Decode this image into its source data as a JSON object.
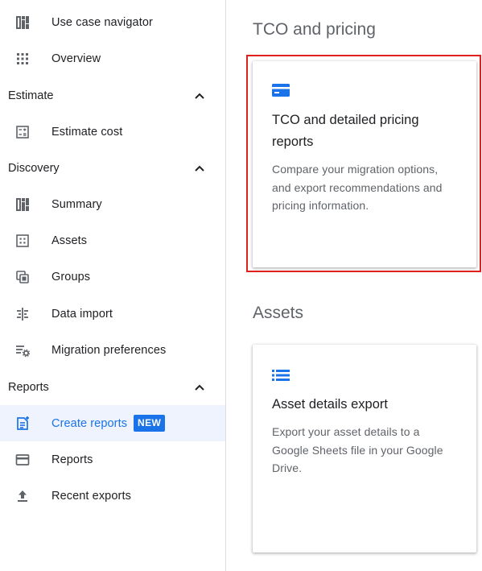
{
  "sidebar": {
    "top_items": [
      {
        "label": "Use case navigator",
        "icon": "dashboard-icon"
      },
      {
        "label": "Overview",
        "icon": "apps-grid-icon"
      }
    ],
    "sections": {
      "estimate": {
        "title": "Estimate",
        "items": [
          {
            "label": "Estimate cost",
            "icon": "calculator-icon"
          }
        ]
      },
      "discovery": {
        "title": "Discovery",
        "items": [
          {
            "label": "Summary",
            "icon": "dashboard-icon"
          },
          {
            "label": "Assets",
            "icon": "assets-icon"
          },
          {
            "label": "Groups",
            "icon": "groups-icon"
          },
          {
            "label": "Data import",
            "icon": "data-import-icon"
          },
          {
            "label": "Migration preferences",
            "icon": "preferences-icon"
          }
        ]
      },
      "reports": {
        "title": "Reports",
        "items": [
          {
            "label": "Create reports",
            "icon": "create-report-icon",
            "badge": "NEW",
            "active": true
          },
          {
            "label": "Reports",
            "icon": "credit-card-icon"
          },
          {
            "label": "Recent exports",
            "icon": "upload-icon"
          }
        ]
      }
    }
  },
  "main": {
    "tco_section": {
      "heading": "TCO and pricing",
      "card": {
        "title": "TCO and detailed pricing reports",
        "description": "Compare your migration options, and export recommendations and pricing information.",
        "icon": "pricing-card-icon"
      }
    },
    "assets_section": {
      "heading": "Assets",
      "card": {
        "title": "Asset details export",
        "description": "Export your asset details to a Google Sheets file in your Google Drive.",
        "icon": "list-icon"
      }
    }
  },
  "colors": {
    "accent": "#1a73e8",
    "active_bg": "#eef3fe",
    "highlight_border": "#e0201c",
    "icon_grey": "#5f6368"
  }
}
